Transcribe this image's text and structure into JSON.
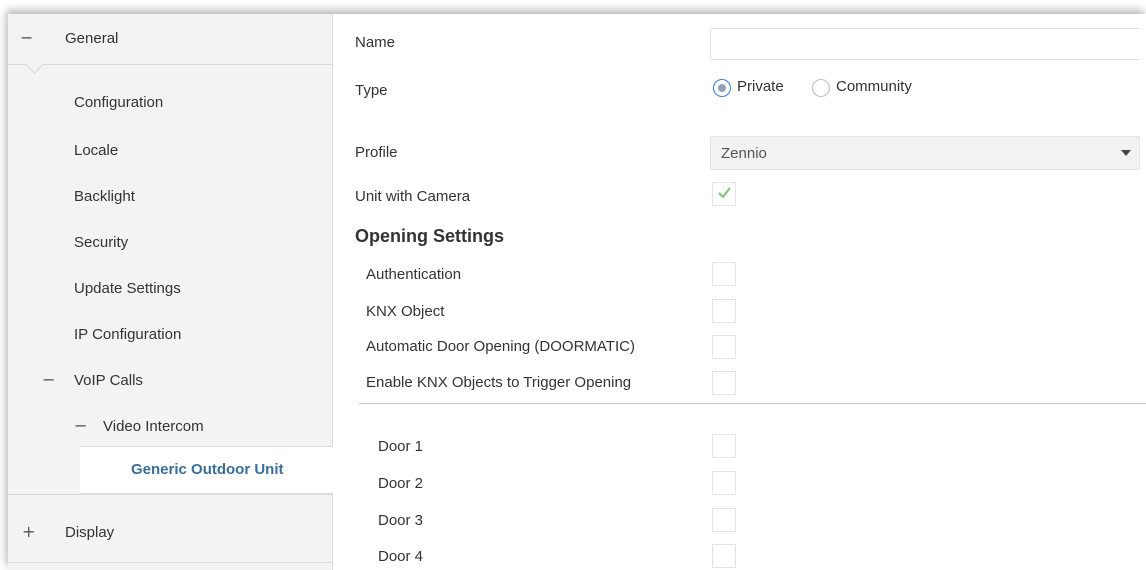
{
  "sidebar": {
    "general": {
      "toggle": "−",
      "label": "General"
    },
    "items": [
      {
        "label": "Configuration"
      },
      {
        "label": "Locale"
      },
      {
        "label": "Backlight"
      },
      {
        "label": "Security"
      },
      {
        "label": "Update Settings"
      },
      {
        "label": "IP Configuration"
      }
    ],
    "voip": {
      "toggle": "−",
      "label": "VoIP Calls"
    },
    "video_intercom": {
      "toggle": "−",
      "label": "Video Intercom"
    },
    "selected": {
      "label": "Generic Outdoor Unit"
    },
    "display": {
      "toggle": "+",
      "label": "Display"
    }
  },
  "form": {
    "name": {
      "label": "Name",
      "value": ""
    },
    "type": {
      "label": "Type",
      "options": [
        {
          "label": "Private",
          "selected": true
        },
        {
          "label": "Community",
          "selected": false
        }
      ]
    },
    "profile": {
      "label": "Profile",
      "value": "Zennio"
    },
    "unit_with_camera": {
      "label": "Unit with Camera",
      "checked": true
    },
    "opening_settings": {
      "title": "Opening Settings",
      "authentication": {
        "label": "Authentication",
        "checked": false
      },
      "knx_object": {
        "label": "KNX Object",
        "checked": false
      },
      "doormatic": {
        "label": "Automatic Door Opening (DOORMATIC)",
        "checked": false
      },
      "enable_knx_trigger": {
        "label": "Enable KNX Objects to Trigger Opening",
        "checked": false
      }
    },
    "doors": [
      {
        "label": "Door 1",
        "checked": false
      },
      {
        "label": "Door 2",
        "checked": false
      },
      {
        "label": "Door 3",
        "checked": false
      },
      {
        "label": "Door 4",
        "checked": false
      }
    ]
  },
  "colors": {
    "accent": "#3a6e9a",
    "check": "#7cc576",
    "radio_ring": "#3a7bd5"
  }
}
